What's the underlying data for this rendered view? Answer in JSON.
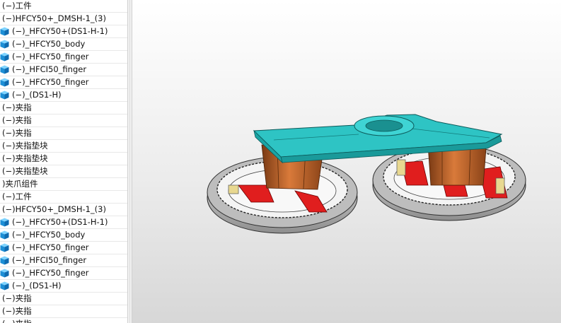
{
  "feature_tree": {
    "items": [
      {
        "label": "(−)工件",
        "icon": "none"
      },
      {
        "label": "(−)HFCY50+_DMSH-1_(3)",
        "icon": "none"
      },
      {
        "label": "(−)_HFCY50+(DS1-H-1)",
        "icon": "part-icon"
      },
      {
        "label": "(−)_HFCY50_body",
        "icon": "part-icon"
      },
      {
        "label": "(−)_HFCY50_finger",
        "icon": "part-icon"
      },
      {
        "label": "(−)_HFCI50_finger",
        "icon": "part-icon"
      },
      {
        "label": "(−)_HFCY50_finger",
        "icon": "part-icon"
      },
      {
        "label": "(−)_(DS1-H)",
        "icon": "part-icon"
      },
      {
        "label": "(−)夹指",
        "icon": "none"
      },
      {
        "label": "(−)夹指",
        "icon": "none"
      },
      {
        "label": "(−)夹指",
        "icon": "none"
      },
      {
        "label": "(−)夹指垫块",
        "icon": "none"
      },
      {
        "label": "(−)夹指垫块",
        "icon": "none"
      },
      {
        "label": "(−)夹指垫块",
        "icon": "none"
      },
      {
        "label": ")夹爪组件",
        "icon": "none"
      },
      {
        "label": "(−)工件",
        "icon": "none"
      },
      {
        "label": "(−)HFCY50+_DMSH-1_(3)",
        "icon": "none"
      },
      {
        "label": "(−)_HFCY50+(DS1-H-1)",
        "icon": "part-icon"
      },
      {
        "label": "(−)_HFCY50_body",
        "icon": "part-icon"
      },
      {
        "label": "(−)_HFCY50_finger",
        "icon": "part-icon"
      },
      {
        "label": "(−)_HFCI50_finger",
        "icon": "part-icon"
      },
      {
        "label": "(−)_HFCY50_finger",
        "icon": "part-icon"
      },
      {
        "label": "(−)_(DS1-H)",
        "icon": "part-icon"
      },
      {
        "label": "(−)夹指",
        "icon": "none"
      },
      {
        "label": "(−)夹指",
        "icon": "none"
      },
      {
        "label": "(−)夹指",
        "icon": "none"
      }
    ]
  },
  "viewport": {
    "model": "gripper-assembly",
    "colors": {
      "plate": "#2ec4c4",
      "body": "#c8652b",
      "finger": "#e01e1e",
      "pad": "#e8d890",
      "ring": "#cfcfcf"
    }
  }
}
